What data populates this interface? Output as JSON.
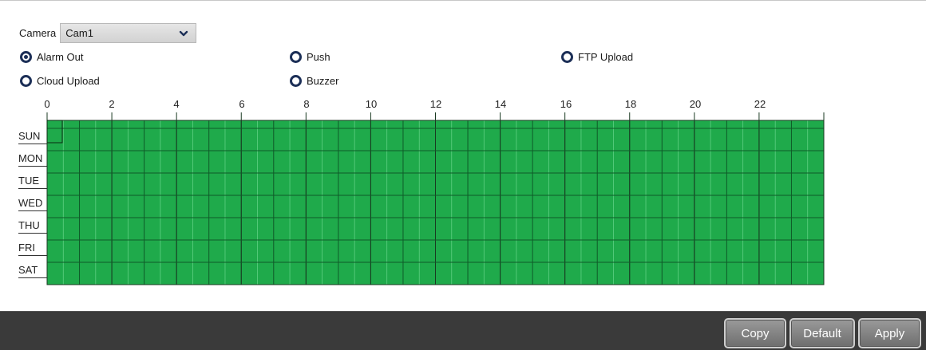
{
  "camera": {
    "label": "Camera",
    "selected": "Cam1"
  },
  "options": [
    {
      "label": "Alarm Out",
      "checked": true
    },
    {
      "label": "Push",
      "checked": false
    },
    {
      "label": "FTP Upload",
      "checked": false
    },
    {
      "label": "Cloud Upload",
      "checked": false
    },
    {
      "label": "Buzzer",
      "checked": false
    }
  ],
  "schedule": {
    "hour_labels": [
      "0",
      "2",
      "4",
      "6",
      "8",
      "10",
      "12",
      "14",
      "16",
      "18",
      "20",
      "22"
    ],
    "days": [
      "SUN",
      "MON",
      "TUE",
      "WED",
      "THU",
      "FRI",
      "SAT"
    ],
    "slots_per_day": 48,
    "all_selected": true,
    "fill_color": "#1faa4b",
    "line_color": "#0f5a28"
  },
  "footer": {
    "copy": "Copy",
    "default": "Default",
    "apply": "Apply"
  }
}
